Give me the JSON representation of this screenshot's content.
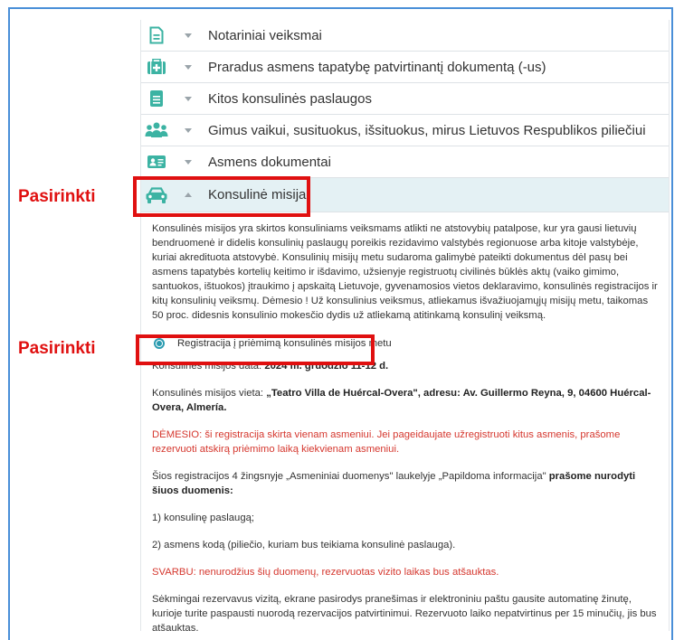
{
  "accordion": [
    {
      "label": "Notariniai veiksmai",
      "icon": "document-icon",
      "expanded": false
    },
    {
      "label": "Praradus asmens tapatybę patvirtinantį dokumentą (-us)",
      "icon": "medical-kit-icon",
      "expanded": false
    },
    {
      "label": "Kitos konsulinės paslaugos",
      "icon": "note-icon",
      "expanded": false
    },
    {
      "label": "Gimus vaikui, susituokus, išsituokus, mirus Lietuvos Respublikos piliečiui",
      "icon": "users-icon",
      "expanded": false
    },
    {
      "label": "Asmens dokumentai",
      "icon": "id-card-icon",
      "expanded": false
    },
    {
      "label": "Konsulinė misija",
      "icon": "car-icon",
      "expanded": true
    }
  ],
  "callouts": {
    "first": "Pasirinkti",
    "second": "Pasirinkti"
  },
  "content": {
    "intro": "Konsulinės misijos yra skirtos konsuliniams veiksmams atlikti ne atstovybių patalpose, kur yra gausi lietuvių bendruomenė ir didelis konsulinių paslaugų poreikis rezidavimo valstybės regionuose arba kitoje valstybėje, kuriai akredituota atstovybė. Konsulinių misijų metu sudaroma galimybė pateikti dokumentus dėl pasų bei asmens tapatybės kortelių keitimo ir išdavimo, užsienyje registruotų civilinės būklės aktų (vaiko gimimo, santuokos, ištuokos) įtraukimo į apskaitą Lietuvoje, gyvenamosios vietos deklaravimo, konsulinės registracijos ir kitų konsulinių veiksmų. Dėmesio ! Už konsulinius veiksmus, atliekamus išvažiuojamųjų misijų metu, taikomas 50 proc. didesnis konsulinio mokesčio dydis už atliekamą atitinkamą konsulinį veiksmą.",
    "radio_label": "Registracija į priėmimą konsulinės misijos metu",
    "date_prefix": "Konsulinės misijos data: ",
    "date_value": "2024 m. gruodžio 11-12 d.",
    "place_prefix": "Konsulinės misijos vieta: ",
    "place_value": "„Teatro Villa de Huércal-Overa\", adresu: Av. Guillermo Reyna, 9, 04600 Huércal-Overa, Almería.",
    "warning": "DĖMESIO: ši registracija skirta vienam asmeniui. Jei pageidaujate užregistruoti kitus asmenis, prašome rezervuoti atskirą priėmimo laiką kiekvienam asmeniui.",
    "step_prefix": "Šios registracijos 4 žingsnyje „Asmeniniai duomenys\" laukelyje „Papildoma informacija\" ",
    "step_bold": "prašome nurodyti šiuos duomenis:",
    "item1": "1) konsulinę paslaugą;",
    "item2": "2) asmens kodą (piliečio, kuriam bus teikiama konsulinė paslauga).",
    "important": "SVARBU: nenurodžius šių duomenų, rezervuotas vizito laikas bus atšauktas.",
    "success": "Sėkmingai rezervavus vizitą, ekrane pasirodys pranešimas ir elektroniniu paštu gausite automatinę žinutę, kurioje turite paspausti nuorodą rezervacijos patvirtinimui. Rezervuoto laiko nepatvirtinus per 15 minučių, jis bus atšauktas."
  },
  "colors": {
    "accent": "#2a9bb0",
    "icon": "#3cb3a3",
    "callout": "#e01010",
    "warning": "#d5372e",
    "frame": "#4a8fd8"
  }
}
